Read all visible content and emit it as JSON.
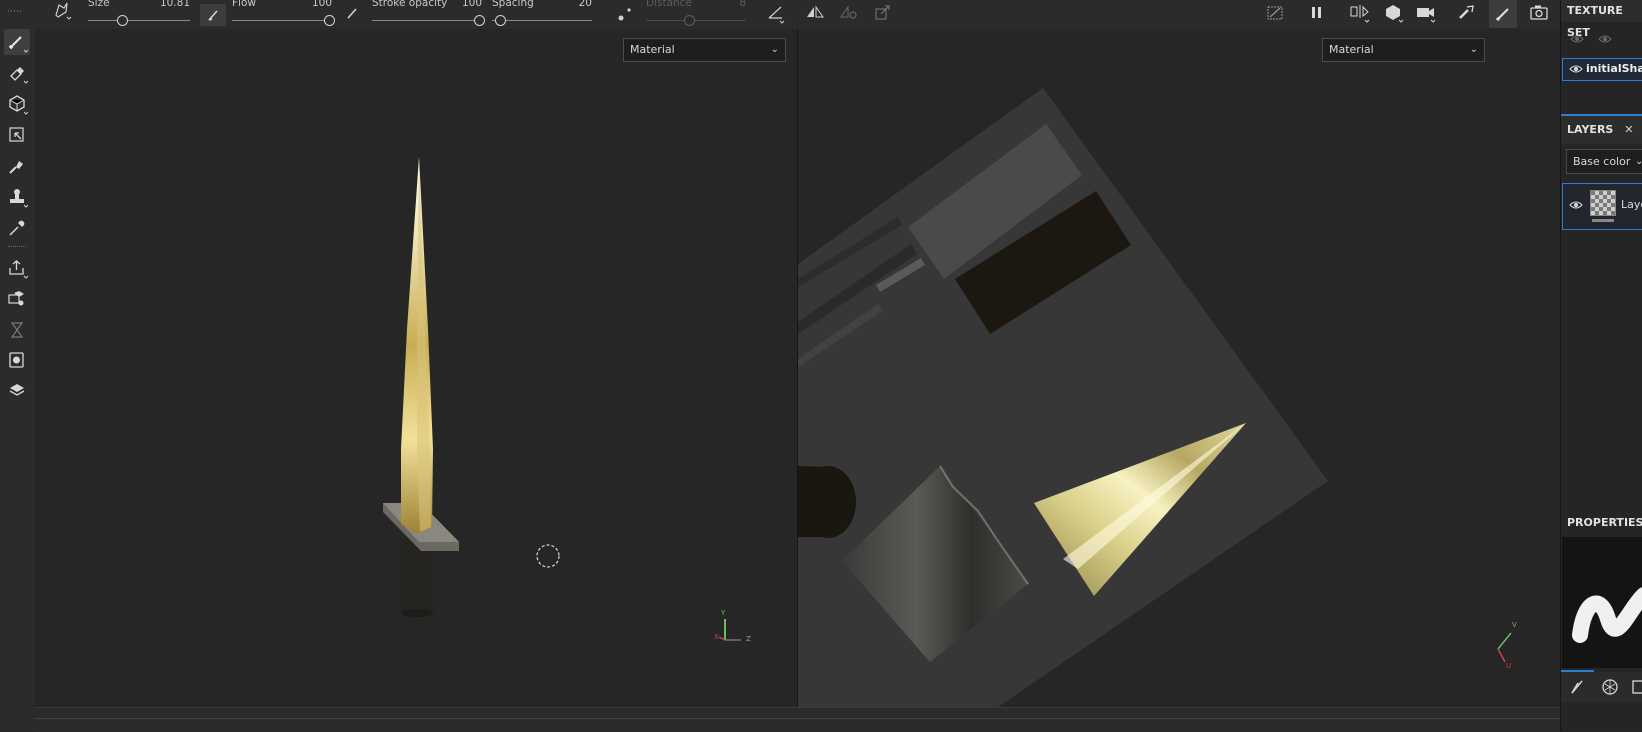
{
  "toolbar": {
    "size": {
      "label": "Size",
      "value": "10.81",
      "fraction": 0.1
    },
    "flow": {
      "label": "Flow",
      "value": "100",
      "fraction": 1.0
    },
    "stroke_opacity": {
      "label": "Stroke opacity",
      "value": "100",
      "fraction": 1.0
    },
    "spacing": {
      "label": "Spacing",
      "value": "20",
      "fraction": 0.05
    },
    "distance": {
      "label": "Distance",
      "value": "8",
      "fraction": 0.5,
      "disabled": true
    }
  },
  "viewport_3d": {
    "material_mode": "Material",
    "axis": {
      "y": "Y",
      "x": "X",
      "z": "Z"
    }
  },
  "viewport_2d": {
    "material_mode": "Material",
    "axis": {
      "v": "V",
      "u": "U"
    }
  },
  "texture_set": {
    "title": "TEXTURE SET",
    "item": "initialShadi"
  },
  "layers": {
    "title": "LAYERS",
    "channel": "Base color",
    "layer_name": "Laye"
  },
  "properties": {
    "title": "PROPERTIES -"
  },
  "colors": {
    "accent": "#2a7fd4",
    "background": "#262626",
    "panel": "#2b2b2b"
  }
}
